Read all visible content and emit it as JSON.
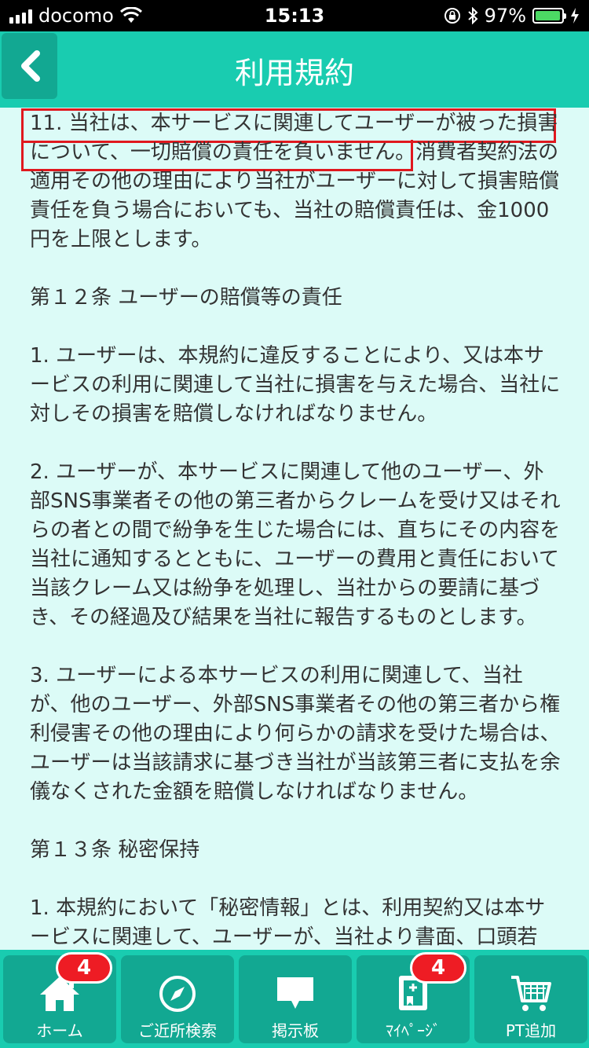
{
  "status_bar": {
    "carrier": "docomo",
    "time": "15:13",
    "battery": "97%",
    "battery_level": 0.97
  },
  "header": {
    "title": "利用規約"
  },
  "content": {
    "paragraphs": [
      "11. 当社は、本サービスに関連してユーザーが被った損害について、一切賠償の責任を負いません。消費者契約法の適用その他の理由により当社がユーザーに対して損害賠償責任を負う場合においても、当社の賠償責任は、金1000円を上限とします。",
      "第１２条 ユーザーの賠償等の責任",
      "1. ユーザーは、本規約に違反することにより、又は本サービスの利用に関連して当社に損害を与えた場合、当社に対しその損害を賠償しなければなりません。",
      "2. ユーザーが、本サービスに関連して他のユーザー、外部SNS事業者その他の第三者からクレームを受け又はそれらの者との間で紛争を生じた場合には、直ちにその内容を当社に通知するとともに、ユーザーの費用と責任において当該クレーム又は紛争を処理し、当社からの要請に基づき、その経過及び結果を当社に報告するものとします。",
      "3. ユーザーによる本サービスの利用に関連して、当社が、他のユーザー、外部SNS事業者その他の第三者から権利侵害その他の理由により何らかの請求を受けた場合は、ユーザーは当該請求に基づき当社が当該第三者に支払を余儀なくされた金額を賠償しなければなりません。",
      "第１３条 秘密保持",
      "1. 本規約において「秘密情報」とは、利用契約又は本サービスに関連して、ユーザーが、当社より書面、口頭若"
    ]
  },
  "tabbar": {
    "tabs": [
      {
        "label": "ホーム",
        "icon": "home-icon",
        "badge": "4"
      },
      {
        "label": "ご近所検索",
        "icon": "compass-icon"
      },
      {
        "label": "掲示板",
        "icon": "speech-bubble-icon"
      },
      {
        "label": "ﾏｲﾍﾟｰｼﾞ",
        "icon": "notebook-icon",
        "badge": "4"
      },
      {
        "label": "PT追加",
        "icon": "cart-icon"
      }
    ]
  },
  "colors": {
    "header": "#19ccb0",
    "tab_button": "#12a892",
    "background": "#dcfbf7",
    "badge": "#ee1c24",
    "highlight": "#e0181e"
  }
}
